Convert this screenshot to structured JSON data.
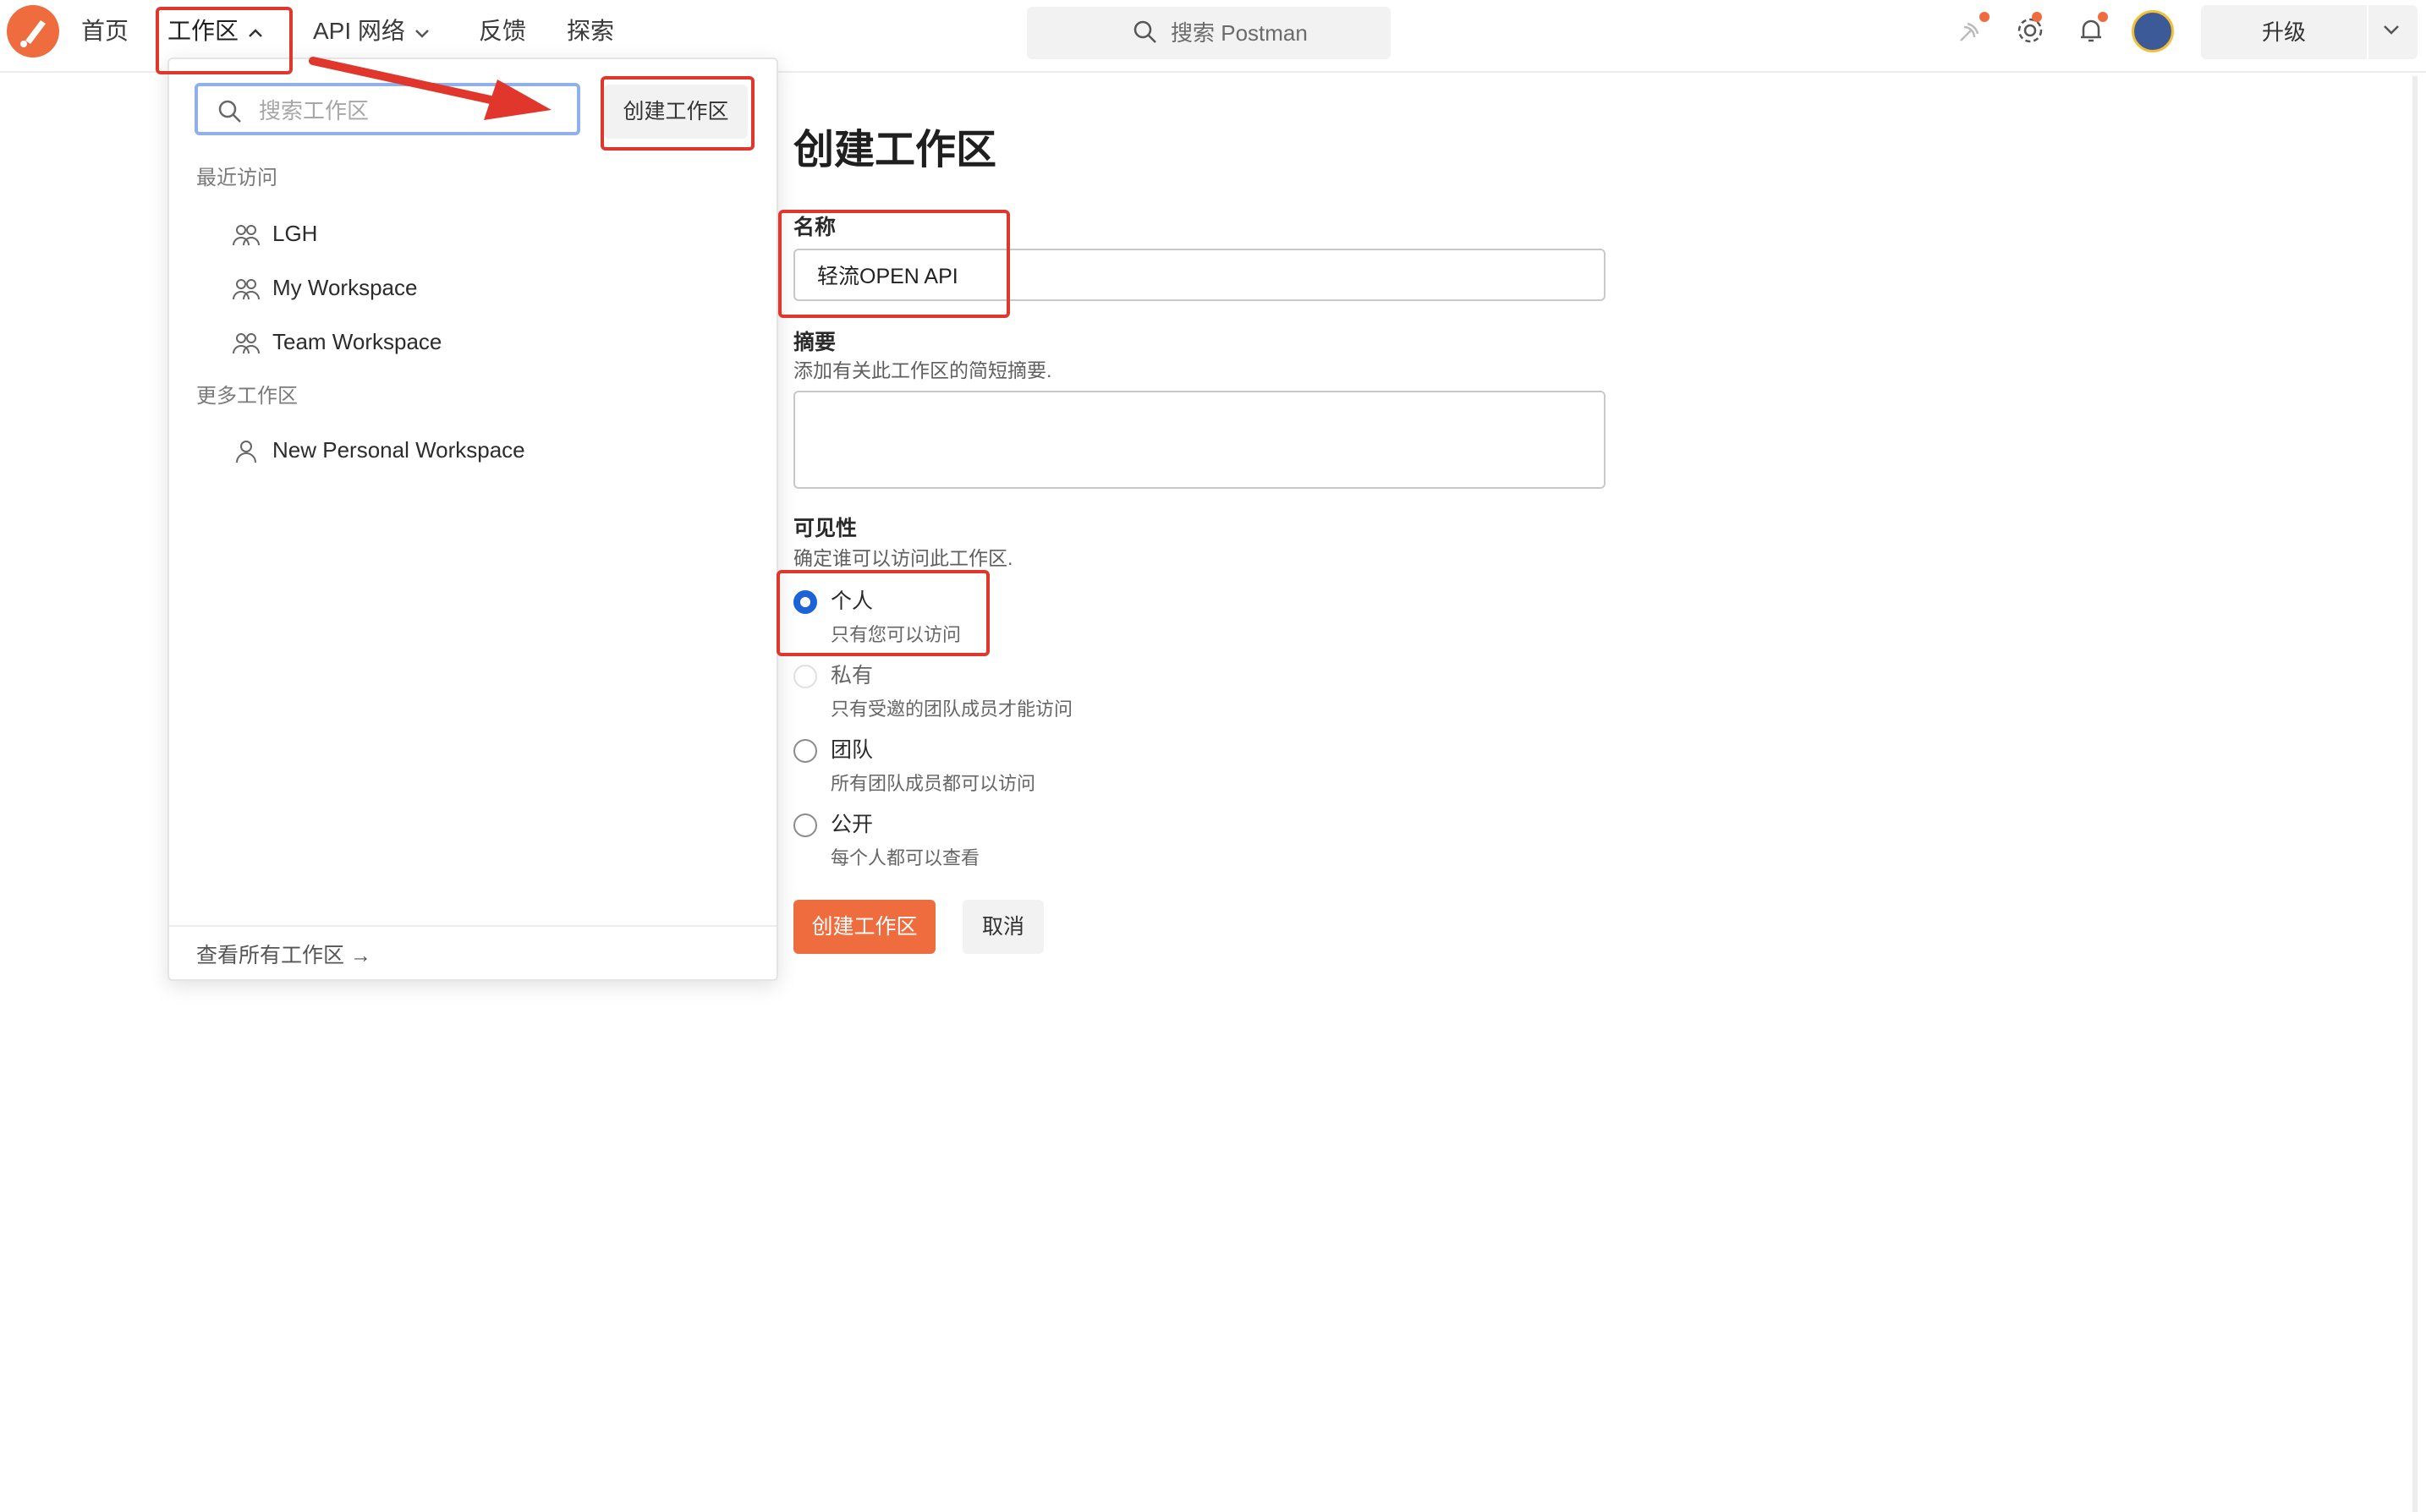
{
  "topbar": {
    "nav": [
      "首页",
      "工作区",
      "API 网络",
      "反馈",
      "探索"
    ],
    "search_placeholder": "搜索 Postman",
    "upgrade_label": "升级",
    "icons": [
      "postman-logo-icon",
      "satellite-icon",
      "gear-icon",
      "bell-icon",
      "avatar"
    ]
  },
  "dropdown": {
    "search_placeholder": "搜索工作区",
    "create_label": "创建工作区",
    "recent_label": "最近访问",
    "recent_items": [
      "LGH",
      "My Workspace",
      "Team Workspace"
    ],
    "more_label": "更多工作区",
    "more_items": [
      "New Personal Workspace"
    ],
    "view_all": "查看所有工作区 →"
  },
  "form": {
    "title": "创建工作区",
    "name_label": "名称",
    "name_value": "轻流OPEN API",
    "summary_label": "摘要",
    "summary_help": "添加有关此工作区的简短摘要.",
    "summary_value": "",
    "visibility_label": "可见性",
    "visibility_help": "确定谁可以访问此工作区.",
    "options": [
      {
        "label": "个人",
        "desc": "只有您可以访问",
        "selected": true,
        "disabled": false
      },
      {
        "label": "私有",
        "desc": "只有受邀的团队成员才能访问",
        "selected": false,
        "disabled": true
      },
      {
        "label": "团队",
        "desc": "所有团队成员都可以访问",
        "selected": false,
        "disabled": false
      },
      {
        "label": "公开",
        "desc": "每个人都可以查看",
        "selected": false,
        "disabled": false
      }
    ],
    "create_label": "创建工作区",
    "cancel_label": "取消"
  },
  "colors": {
    "accent": "#ef6c3e",
    "radio_selected": "#1d63d6",
    "annotation": "#e0362c"
  }
}
